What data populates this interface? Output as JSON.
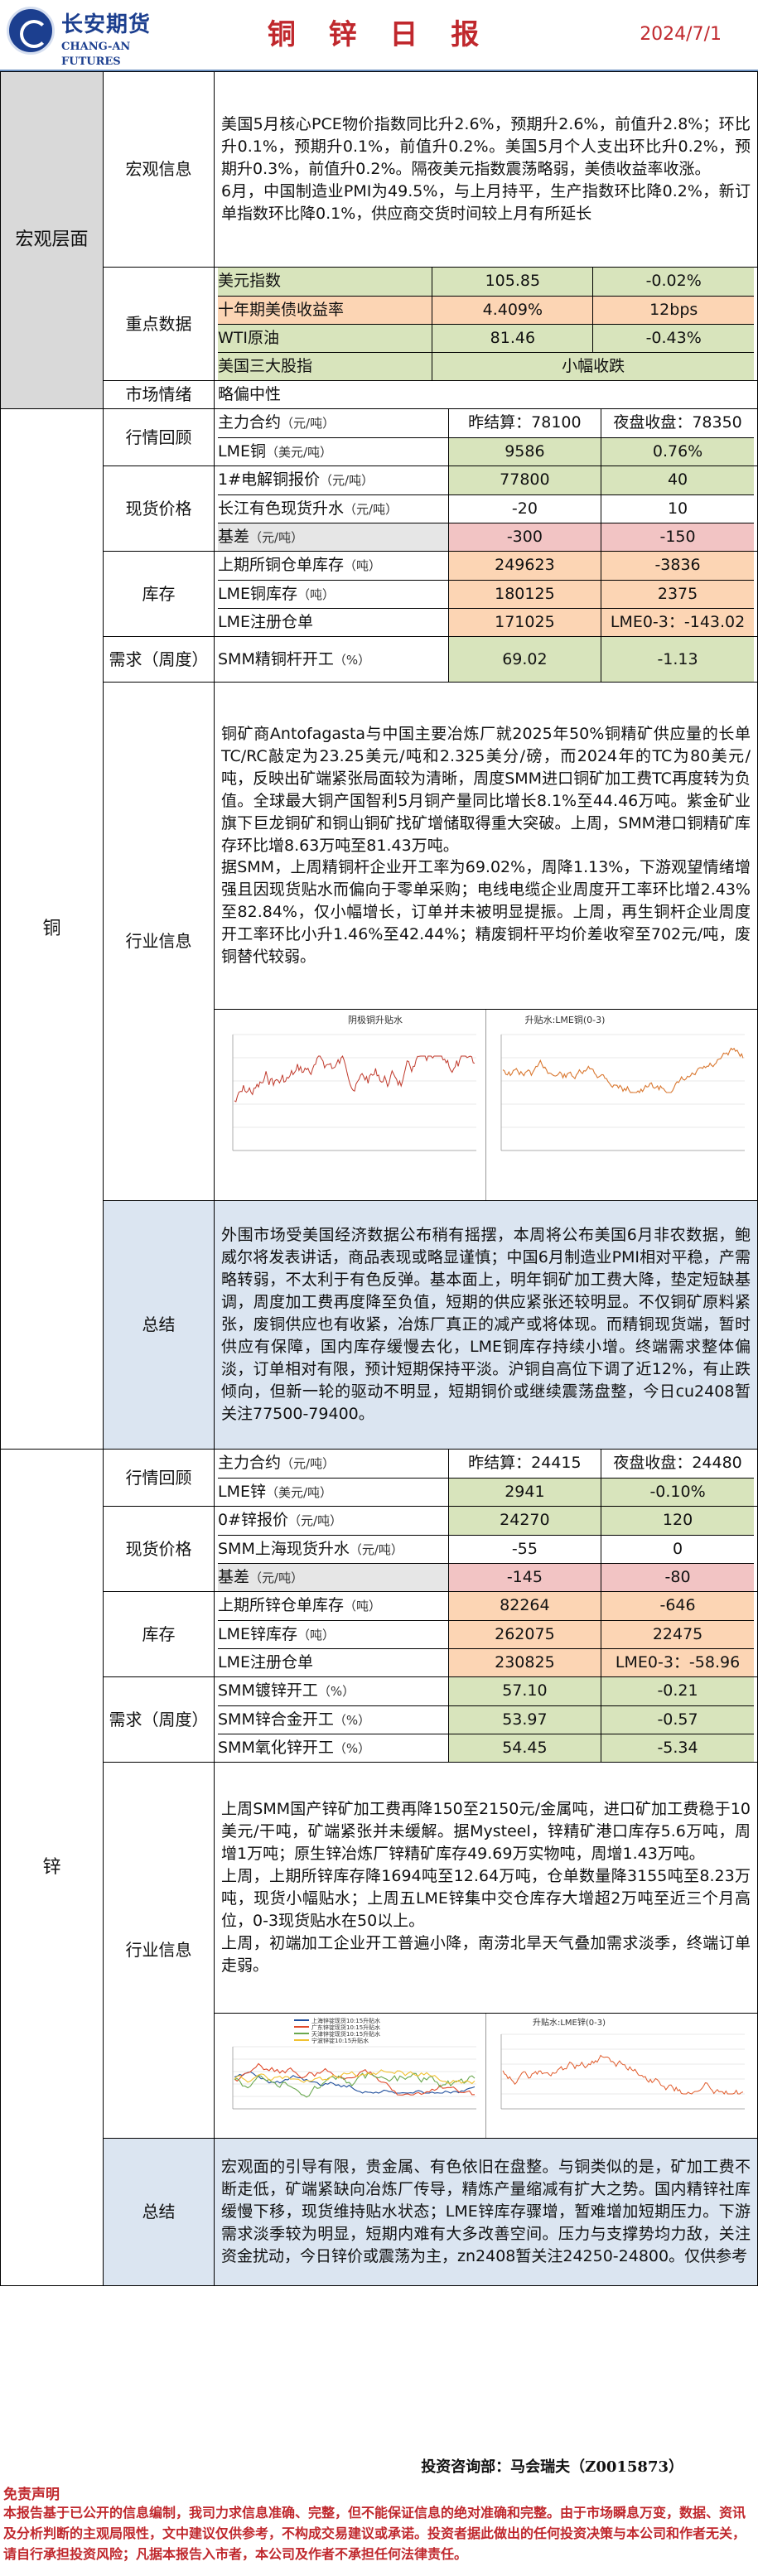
{
  "header": {
    "logo_cn": "长安期货",
    "logo_en": "CHANG-AN FUTURES",
    "title": "铜 锌 日 报",
    "date": "2024/7/1"
  },
  "macro": {
    "section": "宏观层面",
    "info_label": "宏观信息",
    "info_text_1": "美国5月核心PCE物价指数同比升2.6%，预期升2.6%，前值升2.8%；环比升0.1%，预期升0.1%，前值升0.2%。美国5月个人支出环比升0.2%，预期升0.3%，前值升0.2%。隔夜美元指数震荡略弱，美债收益率收涨。",
    "info_text_2": "6月，中国制造业PMI为49.5%，与上月持平，生产指数环比降0.2%，新订单指数环比降0.1%，供应商交货时间较上月有所延长",
    "focus_label": "重点数据",
    "focus_rows": [
      {
        "name": "美元指数",
        "value": "105.85",
        "change": "-0.02%"
      },
      {
        "name": "十年期美债收益率",
        "value": "4.409%",
        "change": "12bps"
      },
      {
        "name": "WTI原油",
        "value": "81.46",
        "change": "-0.43%"
      },
      {
        "name": "美国三大股指",
        "value": "小幅收跌"
      }
    ],
    "sentiment_label": "市场情绪",
    "sentiment_value": "略偏中性"
  },
  "copper": {
    "section": "铜",
    "review_label": "行情回顾",
    "review_rows": [
      {
        "name": "主力合约",
        "unit": "（元/吨）",
        "col1": "昨结算：78100",
        "col2": "夜盘收盘：78350"
      },
      {
        "name": "LME铜",
        "unit": "（美元/吨）",
        "col1": "9586",
        "col2": "0.76%"
      }
    ],
    "spot_label": "现货价格",
    "spot_rows": [
      {
        "name": "1#电解铜报价",
        "unit": "（元/吨）",
        "col1": "77800",
        "col2": "40"
      },
      {
        "name": "长江有色现货升水",
        "unit": "（元/吨）",
        "col1": "-20",
        "col2": "10"
      },
      {
        "name": "基差",
        "unit": "（元/吨）",
        "col1": "-300",
        "col2": "-150"
      }
    ],
    "stock_label": "库存",
    "stock_rows": [
      {
        "name": "上期所铜仓单库存",
        "unit": "（吨）",
        "col1": "249623",
        "col2": "-3836"
      },
      {
        "name": "LME铜库存",
        "unit": "（吨）",
        "col1": "180125",
        "col2": "2375"
      },
      {
        "name": "LME注册仓单",
        "unit": "",
        "col1": "171025",
        "col2": "LME0-3：-143.02"
      }
    ],
    "demand_label": "需求（周度）",
    "demand_rows": [
      {
        "name": "SMM精铜杆开工",
        "unit": "（%）",
        "col1": "69.02",
        "col2": "-1.13"
      }
    ],
    "industry_label": "行业信息",
    "industry_text_1": "铜矿商Antofagasta与中国主要冶炼厂就2025年50%铜精矿供应量的长单TC/RC敲定为23.25美元/吨和2.325美分/磅，而2024年的TC为80美元/吨，反映出矿端紧张局面较为清晰，周度SMM进口铜矿加工费TC再度转为负值。全球最大铜产国智利5月铜产量同比增长8.1%至44.46万吨。紫金矿业旗下巨龙铜矿和铜山铜矿找矿增储取得重大突破。上周，SMM港口铜精矿库存环比增8.63万吨至81.43万吨。",
    "industry_text_2": "据SMM，上周精铜杆企业开工率为69.02%，周降1.13%，下游观望情绪增强且因现货贴水而偏向于零单采购；电线电缆企业周度开工率环比增2.43%至82.84%，仅小幅增长，订单并未被明显提振。上周，再生铜杆企业周度开工率环比小升1.46%至42.44%；精废铜杆平均价差收窄至702元/吨，废铜替代较弱。",
    "chart1_title": "阴极铜升贴水",
    "chart2_title": "升贴水:LME铜(0-3)",
    "summary_label": "总结",
    "summary_text": "外围市场受美国经济数据公布稍有摇摆，本周将公布美国6月非农数据，鲍威尔将发表讲话，商品表现或略显谨慎；中国6月制造业PMI相对平稳，产需略转弱，不太利于有色反弹。基本面上，明年铜矿加工费大降，垫定短缺基调，周度加工费再度降至负值，短期的供应紧张还较明显。不仅铜矿原料紧张，废铜供应也有收紧，冶炼厂真正的减产或将体现。而精铜现货端，暂时供应有保障，国内库存缓慢去化，LME铜库存持续小增。终端需求整体偏淡，订单相对有限，预计短期保持平淡。沪铜自高位下调了近12%，有止跌倾向，但新一轮的驱动不明显，短期铜价或继续震荡盘整，今日cu2408暂关注77500-79400。"
  },
  "zinc": {
    "section": "锌",
    "review_label": "行情回顾",
    "review_rows": [
      {
        "name": "主力合约",
        "unit": "（元/吨）",
        "col1": "昨结算：24415",
        "col2": "夜盘收盘：24480"
      },
      {
        "name": "LME锌",
        "unit": "（美元/吨）",
        "col1": "2941",
        "col2": "-0.10%"
      }
    ],
    "spot_label": "现货价格",
    "spot_rows": [
      {
        "name": "0#锌报价",
        "unit": "（元/吨）",
        "col1": "24270",
        "col2": "120"
      },
      {
        "name": "SMM上海现货升水",
        "unit": "（元/吨）",
        "col1": "-55",
        "col2": "0"
      },
      {
        "name": "基差",
        "unit": "（元/吨）",
        "col1": "-145",
        "col2": "-80"
      }
    ],
    "stock_label": "库存",
    "stock_rows": [
      {
        "name": "上期所锌仓单库存",
        "unit": "（吨）",
        "col1": "82264",
        "col2": "-646"
      },
      {
        "name": "LME锌库存",
        "unit": "（吨）",
        "col1": "262075",
        "col2": "22475"
      },
      {
        "name": "LME注册仓单",
        "unit": "",
        "col1": "230825",
        "col2": "LME0-3：-58.96"
      }
    ],
    "demand_label": "需求（周度）",
    "demand_rows": [
      {
        "name": "SMM镀锌开工",
        "unit": "（%）",
        "col1": "57.10",
        "col2": "-0.21"
      },
      {
        "name": "SMM锌合金开工",
        "unit": "（%）",
        "col1": "53.97",
        "col2": "-0.57"
      },
      {
        "name": "SMM氧化锌开工",
        "unit": "（%）",
        "col1": "54.45",
        "col2": "-5.34"
      }
    ],
    "industry_label": "行业信息",
    "industry_text_1": "上周SMM国产锌矿加工费再降150至2150元/金属吨，进口矿加工费稳于10美元/干吨，矿端紧张并未缓解。据Mysteel，锌精矿港口库存5.6万吨，周增1万吨；原生锌冶炼厂锌精矿库存49.69万实物吨，周增1.43万吨。",
    "industry_text_2": "上周，上期所锌库存降1694吨至12.64万吨，仓单数量降3155吨至8.23万吨，现货小幅贴水；上周五LME锌集中交仓库存大增超2万吨至近三个月高位，0-3现货贴水在50以上。",
    "industry_text_3": "上周，初端加工企业开工普遍小降，南涝北旱天气叠加需求淡季，终端订单走弱。",
    "chart1_legend": [
      "上海锌锭现货10:15升贴水",
      "广东锌锭现货10:15升贴水",
      "天津锌锭现货10:15升贴水",
      "宁波锌锭10:15升贴水"
    ],
    "chart2_title": "升贴水:LME锌(0-3)",
    "summary_label": "总结",
    "summary_text": "宏观面的引导有限，贵金属、有色依旧在盘整。与铜类似的是，矿加工费不断走低，矿端紧缺向冶炼厂传导，精炼产量缩减有扩大之势。国内精锌社库缓慢下移，现货维持贴水状态；LME锌库存骤增，暂难增加短期压力。下游需求淡季较为明显，短期内难有大多改善空间。压力与支撑势均力敌，关注资金扰动，今日锌价或震荡为主，zn2408暂关注24250-24800。仅供参考"
  },
  "footer": {
    "author": "投资咨询部：马会瑞夫（Z0015873）",
    "disclaimer_title": "免责声明",
    "disclaimer": "本报告基于已公开的信息编制，我司力求信息准确、完整，但不能保证信息的绝对准确和完整。由于市场瞬息万变，数据、资讯及分析判断的主观局限性，文中建议仅供参考，不构成交易建议或承诺。投资者据此做出的任何投资决策与本公司和作者无关，请自行承担投资风险；凡据本报告入市者，本公司及作者不承担任何法律责任。"
  },
  "colors": {
    "brand": "#1c3f8f",
    "title_red": "#c0282d",
    "green": "#d8e4bc",
    "orange": "#fcd5b4",
    "blue": "#dbe5f1",
    "pink": "#f2c4c4"
  }
}
